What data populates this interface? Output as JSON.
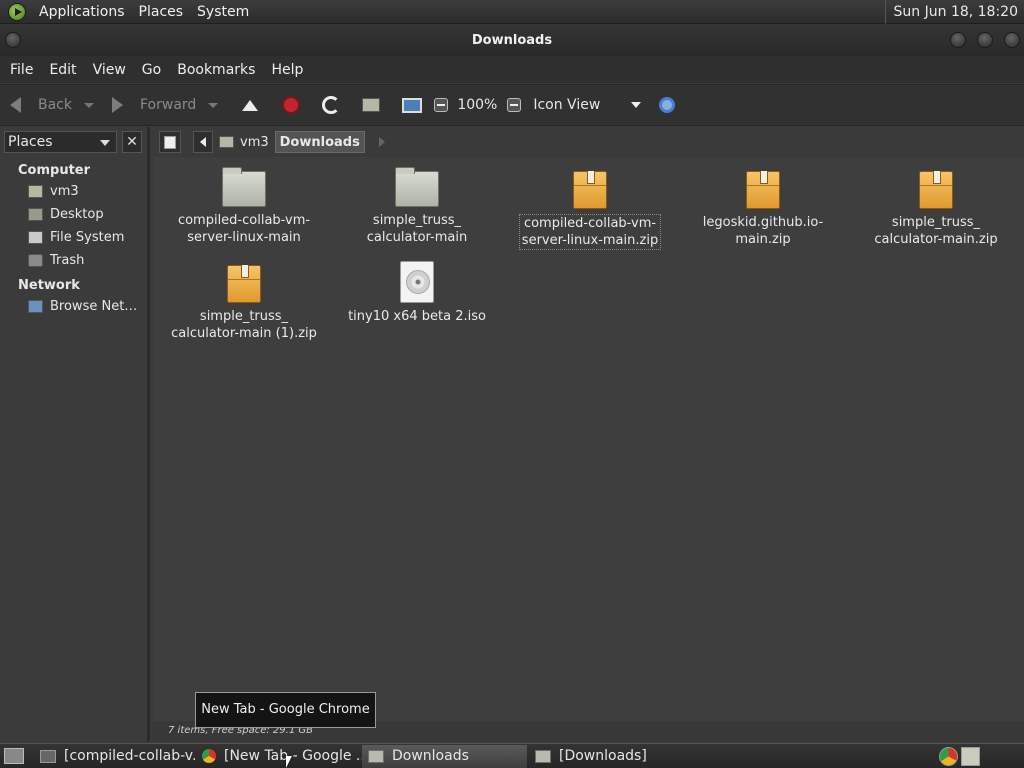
{
  "top_panel": {
    "menus": [
      "Applications",
      "Places",
      "System"
    ],
    "clock": "Sun Jun 18, 18:20"
  },
  "window": {
    "title": "Downloads"
  },
  "menubar": [
    "File",
    "Edit",
    "View",
    "Go",
    "Bookmarks",
    "Help"
  ],
  "toolbar": {
    "back_label": "Back",
    "forward_label": "Forward",
    "zoom_level": "100%",
    "view_mode": "Icon View"
  },
  "sidebar": {
    "selector_label": "Places",
    "close_glyph": "✕",
    "sections": [
      {
        "heading": "Computer",
        "items": [
          "vm3",
          "Desktop",
          "File System",
          "Trash"
        ]
      },
      {
        "heading": "Network",
        "items": [
          "Browse Net…"
        ]
      }
    ]
  },
  "location": {
    "crumbs": [
      "vm3",
      "Downloads"
    ]
  },
  "files": [
    {
      "name": "compiled-collab-vm-server-linux-main",
      "lines": [
        "compiled-collab-vm-",
        "server-linux-main"
      ],
      "type": "folder"
    },
    {
      "name": "simple_truss_calculator-main",
      "lines": [
        "simple_truss_",
        "calculator-main"
      ],
      "type": "folder"
    },
    {
      "name": "compiled-collab-vm-server-linux-main.zip",
      "lines": [
        "compiled-collab-vm-",
        "server-linux-main.zip"
      ],
      "type": "zip"
    },
    {
      "name": "legoskid.github.io-main.zip",
      "lines": [
        "legoskid.github.io-",
        "main.zip"
      ],
      "type": "zip"
    },
    {
      "name": "simple_truss_calculator-main.zip",
      "lines": [
        "simple_truss_",
        "calculator-main.zip"
      ],
      "type": "zip"
    },
    {
      "name": "simple_truss_calculator-main (1).zip",
      "lines": [
        "simple_truss_",
        "calculator-main (1).zip"
      ],
      "type": "zip"
    },
    {
      "name": "tiny10 x64 beta 2.iso",
      "lines": [
        "tiny10 x64 beta 2.iso"
      ],
      "type": "iso"
    }
  ],
  "status": "7 items, Free space: 29.1 GB",
  "tooltip": "New Tab - Google Chrome",
  "taskbar": {
    "tasks": [
      "[compiled-collab-v...",
      "[New Tab - Google ...",
      "Downloads",
      "[Downloads]"
    ]
  }
}
